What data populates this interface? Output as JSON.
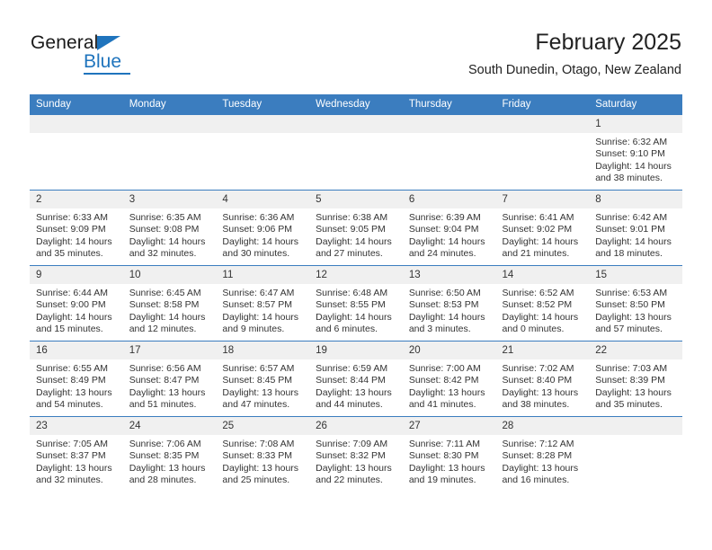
{
  "logo": {
    "word_one": "General",
    "word_two": "Blue",
    "triangle_icon": "triangle-icon"
  },
  "header": {
    "title": "February 2025",
    "subtitle": "South Dunedin, Otago, New Zealand"
  },
  "colors": {
    "header_blue": "#3b7dbf",
    "logo_blue": "#1f74bd",
    "daynum_bg": "#f0f0f0",
    "text": "#333333"
  },
  "calendar": {
    "weekday_headers": [
      "Sunday",
      "Monday",
      "Tuesday",
      "Wednesday",
      "Thursday",
      "Friday",
      "Saturday"
    ],
    "weeks": [
      [
        {
          "day": "",
          "blank": true
        },
        {
          "day": "",
          "blank": true
        },
        {
          "day": "",
          "blank": true
        },
        {
          "day": "",
          "blank": true
        },
        {
          "day": "",
          "blank": true
        },
        {
          "day": "",
          "blank": true
        },
        {
          "day": "1",
          "sunrise": "Sunrise: 6:32 AM",
          "sunset": "Sunset: 9:10 PM",
          "daylight": "Daylight: 14 hours and 38 minutes."
        }
      ],
      [
        {
          "day": "2",
          "sunrise": "Sunrise: 6:33 AM",
          "sunset": "Sunset: 9:09 PM",
          "daylight": "Daylight: 14 hours and 35 minutes."
        },
        {
          "day": "3",
          "sunrise": "Sunrise: 6:35 AM",
          "sunset": "Sunset: 9:08 PM",
          "daylight": "Daylight: 14 hours and 32 minutes."
        },
        {
          "day": "4",
          "sunrise": "Sunrise: 6:36 AM",
          "sunset": "Sunset: 9:06 PM",
          "daylight": "Daylight: 14 hours and 30 minutes."
        },
        {
          "day": "5",
          "sunrise": "Sunrise: 6:38 AM",
          "sunset": "Sunset: 9:05 PM",
          "daylight": "Daylight: 14 hours and 27 minutes."
        },
        {
          "day": "6",
          "sunrise": "Sunrise: 6:39 AM",
          "sunset": "Sunset: 9:04 PM",
          "daylight": "Daylight: 14 hours and 24 minutes."
        },
        {
          "day": "7",
          "sunrise": "Sunrise: 6:41 AM",
          "sunset": "Sunset: 9:02 PM",
          "daylight": "Daylight: 14 hours and 21 minutes."
        },
        {
          "day": "8",
          "sunrise": "Sunrise: 6:42 AM",
          "sunset": "Sunset: 9:01 PM",
          "daylight": "Daylight: 14 hours and 18 minutes."
        }
      ],
      [
        {
          "day": "9",
          "sunrise": "Sunrise: 6:44 AM",
          "sunset": "Sunset: 9:00 PM",
          "daylight": "Daylight: 14 hours and 15 minutes."
        },
        {
          "day": "10",
          "sunrise": "Sunrise: 6:45 AM",
          "sunset": "Sunset: 8:58 PM",
          "daylight": "Daylight: 14 hours and 12 minutes."
        },
        {
          "day": "11",
          "sunrise": "Sunrise: 6:47 AM",
          "sunset": "Sunset: 8:57 PM",
          "daylight": "Daylight: 14 hours and 9 minutes."
        },
        {
          "day": "12",
          "sunrise": "Sunrise: 6:48 AM",
          "sunset": "Sunset: 8:55 PM",
          "daylight": "Daylight: 14 hours and 6 minutes."
        },
        {
          "day": "13",
          "sunrise": "Sunrise: 6:50 AM",
          "sunset": "Sunset: 8:53 PM",
          "daylight": "Daylight: 14 hours and 3 minutes."
        },
        {
          "day": "14",
          "sunrise": "Sunrise: 6:52 AM",
          "sunset": "Sunset: 8:52 PM",
          "daylight": "Daylight: 14 hours and 0 minutes."
        },
        {
          "day": "15",
          "sunrise": "Sunrise: 6:53 AM",
          "sunset": "Sunset: 8:50 PM",
          "daylight": "Daylight: 13 hours and 57 minutes."
        }
      ],
      [
        {
          "day": "16",
          "sunrise": "Sunrise: 6:55 AM",
          "sunset": "Sunset: 8:49 PM",
          "daylight": "Daylight: 13 hours and 54 minutes."
        },
        {
          "day": "17",
          "sunrise": "Sunrise: 6:56 AM",
          "sunset": "Sunset: 8:47 PM",
          "daylight": "Daylight: 13 hours and 51 minutes."
        },
        {
          "day": "18",
          "sunrise": "Sunrise: 6:57 AM",
          "sunset": "Sunset: 8:45 PM",
          "daylight": "Daylight: 13 hours and 47 minutes."
        },
        {
          "day": "19",
          "sunrise": "Sunrise: 6:59 AM",
          "sunset": "Sunset: 8:44 PM",
          "daylight": "Daylight: 13 hours and 44 minutes."
        },
        {
          "day": "20",
          "sunrise": "Sunrise: 7:00 AM",
          "sunset": "Sunset: 8:42 PM",
          "daylight": "Daylight: 13 hours and 41 minutes."
        },
        {
          "day": "21",
          "sunrise": "Sunrise: 7:02 AM",
          "sunset": "Sunset: 8:40 PM",
          "daylight": "Daylight: 13 hours and 38 minutes."
        },
        {
          "day": "22",
          "sunrise": "Sunrise: 7:03 AM",
          "sunset": "Sunset: 8:39 PM",
          "daylight": "Daylight: 13 hours and 35 minutes."
        }
      ],
      [
        {
          "day": "23",
          "sunrise": "Sunrise: 7:05 AM",
          "sunset": "Sunset: 8:37 PM",
          "daylight": "Daylight: 13 hours and 32 minutes."
        },
        {
          "day": "24",
          "sunrise": "Sunrise: 7:06 AM",
          "sunset": "Sunset: 8:35 PM",
          "daylight": "Daylight: 13 hours and 28 minutes."
        },
        {
          "day": "25",
          "sunrise": "Sunrise: 7:08 AM",
          "sunset": "Sunset: 8:33 PM",
          "daylight": "Daylight: 13 hours and 25 minutes."
        },
        {
          "day": "26",
          "sunrise": "Sunrise: 7:09 AM",
          "sunset": "Sunset: 8:32 PM",
          "daylight": "Daylight: 13 hours and 22 minutes."
        },
        {
          "day": "27",
          "sunrise": "Sunrise: 7:11 AM",
          "sunset": "Sunset: 8:30 PM",
          "daylight": "Daylight: 13 hours and 19 minutes."
        },
        {
          "day": "28",
          "sunrise": "Sunrise: 7:12 AM",
          "sunset": "Sunset: 8:28 PM",
          "daylight": "Daylight: 13 hours and 16 minutes."
        },
        {
          "day": "",
          "blank": true
        }
      ]
    ]
  }
}
